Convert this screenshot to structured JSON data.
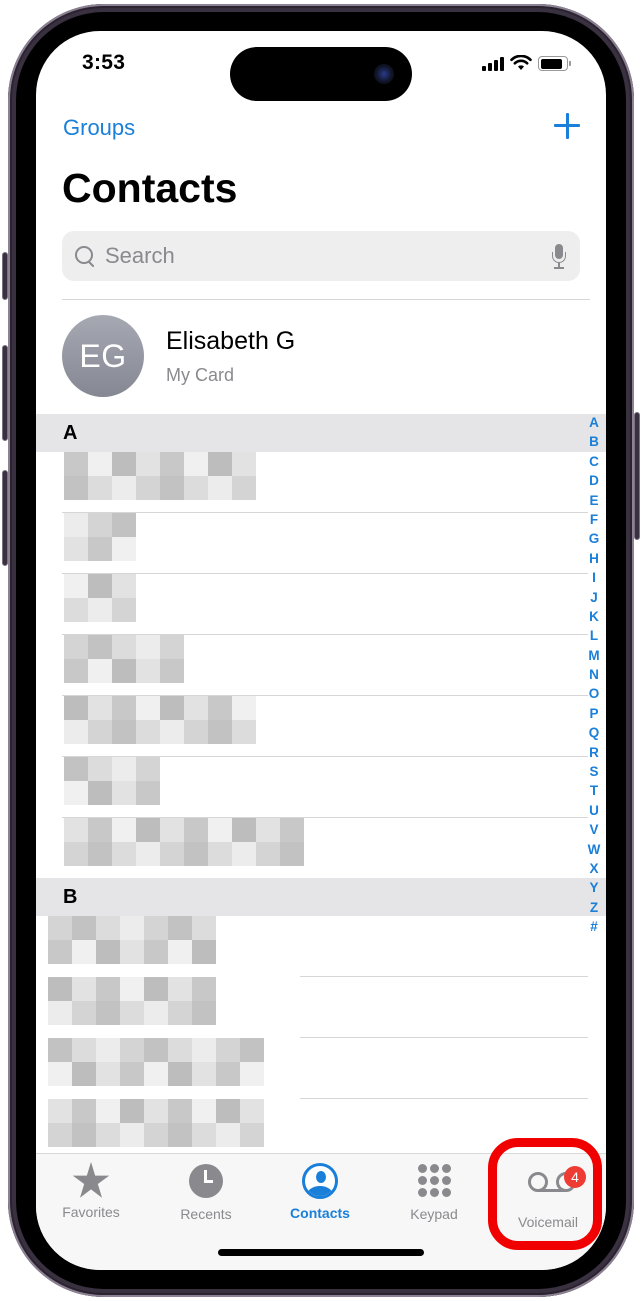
{
  "status_bar": {
    "time": "3:53",
    "icons": [
      "cellular-signal-icon",
      "wifi-icon",
      "battery-icon"
    ]
  },
  "nav": {
    "groups_label": "Groups",
    "add_icon": "plus-icon"
  },
  "page_title": "Contacts",
  "search": {
    "placeholder": "Search",
    "icon": "magnifying-glass-icon",
    "mic_icon": "microphone-icon"
  },
  "my_card": {
    "initials": "EG",
    "name": "Elisabeth G",
    "subtitle": "My Card"
  },
  "sections": [
    {
      "letter": "A",
      "rows": [
        {
          "name": "[redacted]"
        },
        {
          "name": "[redacted]"
        },
        {
          "name": "[redacted]"
        },
        {
          "name": "[redacted]"
        },
        {
          "name": "[redacted]"
        },
        {
          "name": "[redacted]"
        },
        {
          "name": "[redacted]"
        }
      ]
    },
    {
      "letter": "B",
      "rows": [
        {
          "name": "[redacted]"
        },
        {
          "name": "[redacted]"
        },
        {
          "name": "[redacted]"
        },
        {
          "name": "[redacted]"
        }
      ]
    }
  ],
  "index_letters": [
    "A",
    "B",
    "C",
    "D",
    "E",
    "F",
    "G",
    "H",
    "I",
    "J",
    "K",
    "L",
    "M",
    "N",
    "O",
    "P",
    "Q",
    "R",
    "S",
    "T",
    "U",
    "V",
    "W",
    "X",
    "Y",
    "Z",
    "#"
  ],
  "tabbar": {
    "tabs": [
      {
        "label": "Favorites",
        "icon": "star-icon",
        "active": false
      },
      {
        "label": "Recents",
        "icon": "clock-icon",
        "active": false
      },
      {
        "label": "Contacts",
        "icon": "person-circle-icon",
        "active": true
      },
      {
        "label": "Keypad",
        "icon": "keypad-icon",
        "active": false
      },
      {
        "label": "Voicemail",
        "icon": "voicemail-icon",
        "active": false,
        "badge": "4"
      }
    ]
  },
  "annotation": {
    "type": "highlight-ring",
    "target": "Voicemail",
    "color": "#f00000"
  },
  "colors": {
    "accent": "#1a7fd9",
    "badge": "#ee3b34",
    "inactive": "#8a8a8e"
  }
}
